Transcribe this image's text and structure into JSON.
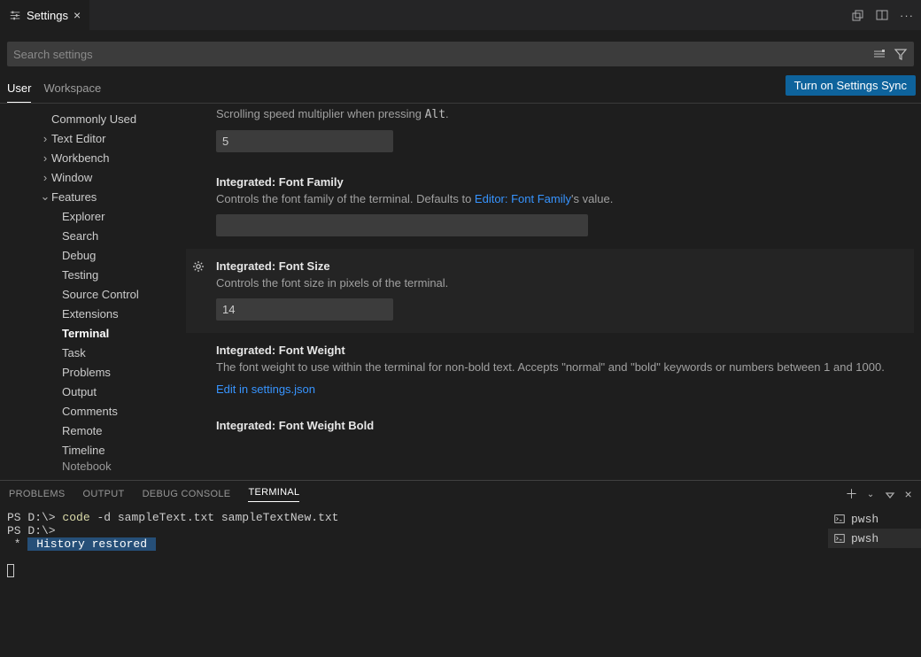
{
  "tab": {
    "title": "Settings"
  },
  "search": {
    "placeholder": "Search settings"
  },
  "scope": {
    "user": "User",
    "workspace": "Workspace",
    "sync": "Turn on Settings Sync"
  },
  "tree": {
    "commonly_used": "Commonly Used",
    "text_editor": "Text Editor",
    "workbench": "Workbench",
    "window": "Window",
    "features": "Features",
    "explorer": "Explorer",
    "search": "Search",
    "debug": "Debug",
    "testing": "Testing",
    "source_control": "Source Control",
    "extensions": "Extensions",
    "terminal": "Terminal",
    "task": "Task",
    "problems": "Problems",
    "output": "Output",
    "comments": "Comments",
    "remote": "Remote",
    "timeline": "Timeline",
    "notebook": "Notebook"
  },
  "settings": {
    "scroll_speed": {
      "desc_prefix": "Scrolling speed multiplier when pressing ",
      "desc_kbd": "Alt",
      "value": "5"
    },
    "font_family": {
      "prefix": "Integrated: ",
      "title": "Font Family",
      "desc_prefix": "Controls the font family of the terminal. Defaults to ",
      "desc_link": "Editor: Font Family",
      "desc_suffix": "'s value.",
      "value": ""
    },
    "font_size": {
      "prefix": "Integrated: ",
      "title": "Font Size",
      "desc": "Controls the font size in pixels of the terminal.",
      "value": "14"
    },
    "font_weight": {
      "prefix": "Integrated: ",
      "title": "Font Weight",
      "desc": "The font weight to use within the terminal for non-bold text. Accepts \"normal\" and \"bold\" keywords or numbers between 1 and 1000.",
      "link": "Edit in settings.json"
    },
    "font_weight_bold": {
      "prefix": "Integrated: ",
      "title": "Font Weight Bold"
    }
  },
  "panel": {
    "tabs": {
      "problems": "PROBLEMS",
      "output": "OUTPUT",
      "debug_console": "DEBUG CONSOLE",
      "terminal": "TERMINAL"
    },
    "terminal": {
      "line1_prompt": "PS D:\\> ",
      "line1_cmd": "code",
      "line1_args": " -d sampleText.txt sampleTextNew.txt",
      "line2_prompt": "PS D:\\>",
      "history_prefix": " * ",
      "history_msg": " History restored ",
      "sessions": {
        "a": "pwsh",
        "b": "pwsh"
      }
    }
  }
}
